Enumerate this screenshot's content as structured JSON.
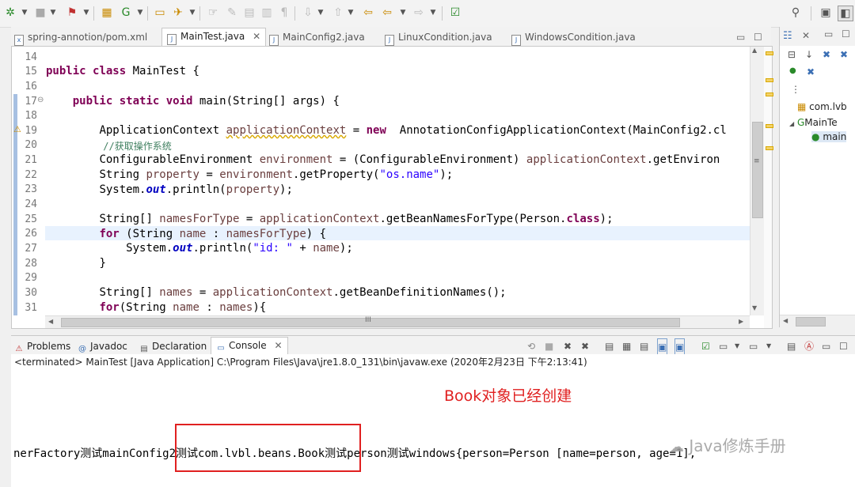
{
  "editor_tabs": [
    {
      "label": "spring-annotion/pom.xml",
      "icon": "xml-file-icon"
    },
    {
      "label": "MainTest.java",
      "icon": "java-file-icon",
      "active": true
    },
    {
      "label": "MainConfig2.java",
      "icon": "java-file-icon"
    },
    {
      "label": "LinuxCondition.java",
      "icon": "java-file-icon"
    },
    {
      "label": "WindowsCondition.java",
      "icon": "java-file-icon"
    }
  ],
  "editor": {
    "line_numbers": [
      "14",
      "15",
      "16",
      "17",
      "18",
      "19",
      "20",
      "21",
      "22",
      "23",
      "24",
      "25",
      "26",
      "27",
      "28",
      "29",
      "30",
      "31"
    ],
    "fold_marker": "⊖",
    "line15": {
      "kw1": "public",
      "kw2": "class",
      "rest": " MainTest {"
    },
    "line17": {
      "kw1": "public",
      "kw2": "static",
      "kw3": "void",
      "rest": " main(String[] args) {"
    },
    "line19": {
      "a": "ApplicationContext ",
      "var": "applicationContext",
      "b": " = ",
      "kw": "new",
      "c": " AnnotationConfigApplicationContext(MainConfig2.cl"
    },
    "line20": {
      "comment": "//获取操作系统"
    },
    "line21": {
      "a": "ConfigurableEnvironment ",
      "var": "environment",
      "b": " = (ConfigurableEnvironment) ",
      "var2": "applicationContext",
      "c": ".getEnviron"
    },
    "line22": {
      "a": "String ",
      "var": "property",
      "b": " = ",
      "var2": "environment",
      "c": ".getProperty(",
      "str": "\"os.name\"",
      "d": ");"
    },
    "line23": {
      "a": "System.",
      "fld": "out",
      "b": ".println(",
      "var": "property",
      "c": ");"
    },
    "line25": {
      "a": "String[] ",
      "var": "namesForType",
      "b": " = ",
      "var2": "applicationContext",
      "c": ".getBeanNamesForType(Person.",
      "kw": "class",
      "d": ");"
    },
    "line26": {
      "kw": "for",
      "a": " (String ",
      "var": "name",
      "b": " : ",
      "var2": "namesForType",
      "c": ") {"
    },
    "line27": {
      "a": "System.",
      "fld": "out",
      "b": ".println(",
      "str": "\"id: \"",
      "c": " + ",
      "var": "name",
      "d": ");"
    },
    "line28": {
      "a": "}"
    },
    "line30": {
      "a": "String[] ",
      "var": "names",
      "b": " = ",
      "var2": "applicationContext",
      "c": ".getBeanDefinitionNames();"
    },
    "line31": {
      "kw": "for",
      "a": "(String ",
      "var": "name",
      "b": " : ",
      "var2": "names",
      "c": "){"
    },
    "hscroll_grip": "III"
  },
  "outline": {
    "package": "com.lvb",
    "class": "MainTe",
    "method": "main"
  },
  "console_tabs": [
    {
      "label": "Problems",
      "icon": "problems-icon"
    },
    {
      "label": "Javadoc",
      "icon": "javadoc-icon"
    },
    {
      "label": "Declaration",
      "icon": "declaration-icon"
    },
    {
      "label": "Console",
      "icon": "console-icon",
      "active": true
    }
  ],
  "console": {
    "status": "<terminated> MainTest [Java Application] C:\\Program Files\\Java\\jre1.8.0_131\\bin\\javaw.exe (2020年2月23日 下午2:13:41)",
    "output": "nerFactory测试mainConfig2测试com.lvbl.beans.Book测试person测试windows{person=Person [name=person, age=1],",
    "annotation": "Book对象已经创建",
    "watermark": "Java修炼手册"
  },
  "colors": {
    "keyword": "#7f0055",
    "string": "#2a00ff",
    "comment": "#3f7f5f",
    "field": "#0000c0",
    "annotation": "#e02020"
  }
}
